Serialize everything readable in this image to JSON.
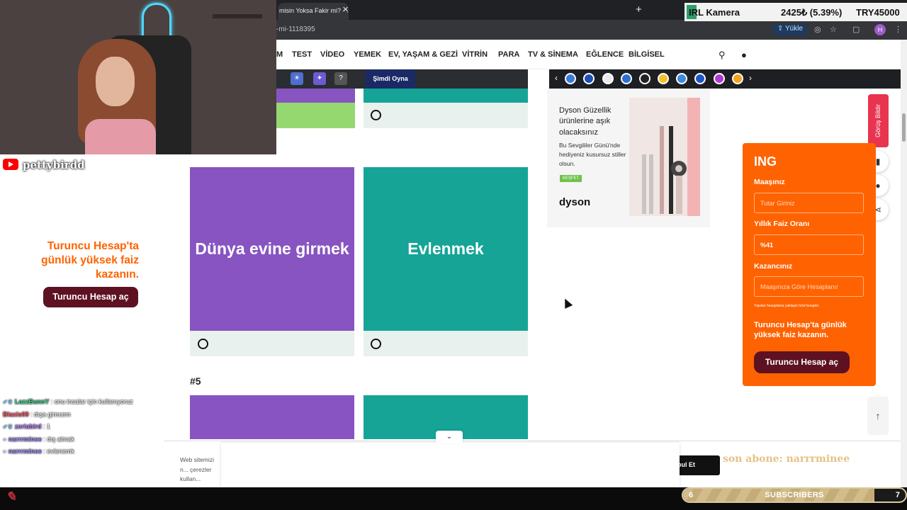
{
  "browser": {
    "tab_title": "misin Yoksa Fakir mi? - ...",
    "url": "-mi-1118395",
    "yukle_label": "Yükle",
    "profile_initial": "H"
  },
  "ticker": {
    "label": "IRL Kamera",
    "price": "2425₺ (5.39%)",
    "goal": "TRY45000"
  },
  "site_nav": {
    "items": [
      "M",
      "TEST",
      "VİDEO",
      "YEMEK",
      "EV, YAŞAM & GEZİ",
      "VİTRİN",
      "PARA",
      "TV & SİNEMA",
      "EĞLENCE",
      "BİLGİSEL"
    ]
  },
  "game_strip": {
    "play_label": "Şimdi Oyna",
    "question_mark": "?"
  },
  "quiz": {
    "cards": [
      {
        "label": "Dünya evine girmek",
        "color": "#8754c1"
      },
      {
        "label": "Evlenmek",
        "color": "#16a497"
      }
    ],
    "next_number": "#5"
  },
  "dyson_ad": {
    "headline": "Dyson Güzellik ürünlerine aşık olacaksınız",
    "sub": "Bu Sevgililer Günü'nde hediyeniz kusursuz stiller olsun.",
    "tag": "KEŞFET",
    "logo": "dyson"
  },
  "side_rail": {
    "feedback_label": "Görüş Bildir"
  },
  "ing_calc": {
    "logo": "ING",
    "salary_label": "Maaşınız",
    "salary_placeholder": "Tutar Giriniz",
    "rate_label": "Yıllık Faiz Oranı",
    "rate_value": "%41",
    "earn_label": "Kazancınız",
    "earn_placeholder": "Maaşınıza Göre Hesaplanır",
    "fine_print": "Yapılan hesaplama yaklaşık brüt hesaptır.",
    "promo": "Turuncu Hesap'ta günlük yüksek faiz kazanın.",
    "button": "Turuncu Hesap aç"
  },
  "left_ad": {
    "text": "Turuncu Hesap'ta günlük yüksek faiz kazanın.",
    "button": "Turuncu Hesap aç"
  },
  "cookie": {
    "text": "Web sitemizi n... çerezler kullan...",
    "button": "bul Et"
  },
  "stream": {
    "channel": "pettybirdd",
    "chat": [
      {
        "user": "LazzBunnY",
        "user_color": "#3fd08b",
        "msg": "onu insalar için kullanıyoruz",
        "badges": "✔︎♛"
      },
      {
        "user": "Blaxis09",
        "user_color": "#ff5a6e",
        "msg": "dışa girecem",
        "badges": ""
      },
      {
        "user": "zeriabird",
        "user_color": "#b57bff",
        "msg": "1",
        "badges": "✔︎♛"
      },
      {
        "user": "narrrminee",
        "user_color": "#9b8cff",
        "msg": "dış almak",
        "badges": "○"
      },
      {
        "user": "narrrminee",
        "user_color": "#9b8cff",
        "msg": "evlenemk",
        "badges": "○"
      }
    ],
    "last_sub": "son abone: narrrminee",
    "subs_current": "6",
    "subs_label": "SUBSCRIBERS",
    "subs_goal": "7",
    "subs_progress": 0.86
  }
}
